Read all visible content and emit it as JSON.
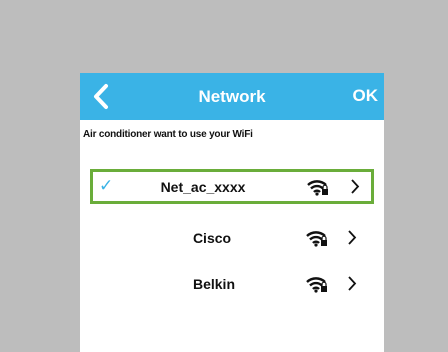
{
  "header": {
    "title": "Network",
    "ok_label": "OK",
    "back_icon": "chevron-left-icon"
  },
  "subtitle": "Air conditioner want to use your WiFi",
  "networks": [
    {
      "name": "Net_ac_xxxx",
      "selected": true,
      "icon": "wifi-lock-icon"
    },
    {
      "name": "Cisco",
      "selected": false,
      "icon": "wifi-lock-icon"
    },
    {
      "name": "Belkin",
      "selected": false,
      "icon": "wifi-lock-icon"
    }
  ],
  "colors": {
    "header": "#3ab3e6",
    "selected_border": "#6aad3a",
    "background": "#bdbdbd",
    "check": "#3ab3e6"
  },
  "check_glyph": "✓",
  "chevron_icon": "chevron-right-icon"
}
